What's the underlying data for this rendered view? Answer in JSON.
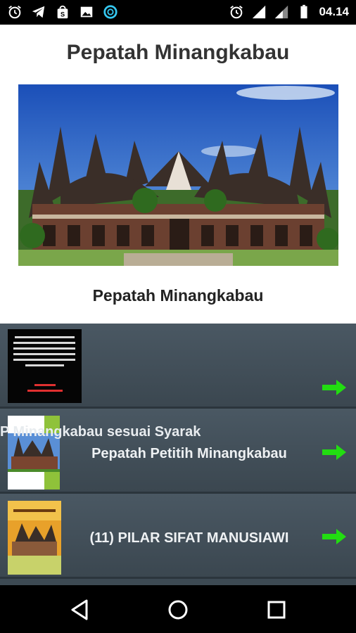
{
  "status_bar": {
    "time": "04.14",
    "left_icons": [
      "alarm-icon",
      "telegram-icon",
      "shop-bag-icon",
      "image-icon",
      "circle-app-icon"
    ],
    "right_icons": [
      "alarm-icon",
      "signal-icon",
      "signal-icon",
      "battery-icon"
    ]
  },
  "header": {
    "title": "Pepatah Minangkabau",
    "hero_image": "minangkabau-house-image",
    "subtitle": "Pepatah Minangkabau"
  },
  "list": {
    "items": [
      {
        "thumb": "black-text-poster-thumbnail",
        "label": "",
        "arrow": "arrow-right-icon"
      },
      {
        "thumb": "minangkabau-house-thumbnail",
        "label": "Pepatah Petitih Minangkabau",
        "overlay_text": "P Minangkabau sesuai Syarak",
        "arrow": "arrow-right-icon"
      },
      {
        "thumb": "book-cover-thumbnail",
        "label": "(11) PILAR SIFAT MANUSIAWI",
        "arrow": "arrow-right-icon"
      }
    ]
  },
  "colors": {
    "list_bg": "#3d4a53",
    "arrow": "#22dd11"
  },
  "nav": [
    "back-icon",
    "home-icon",
    "recents-icon"
  ]
}
